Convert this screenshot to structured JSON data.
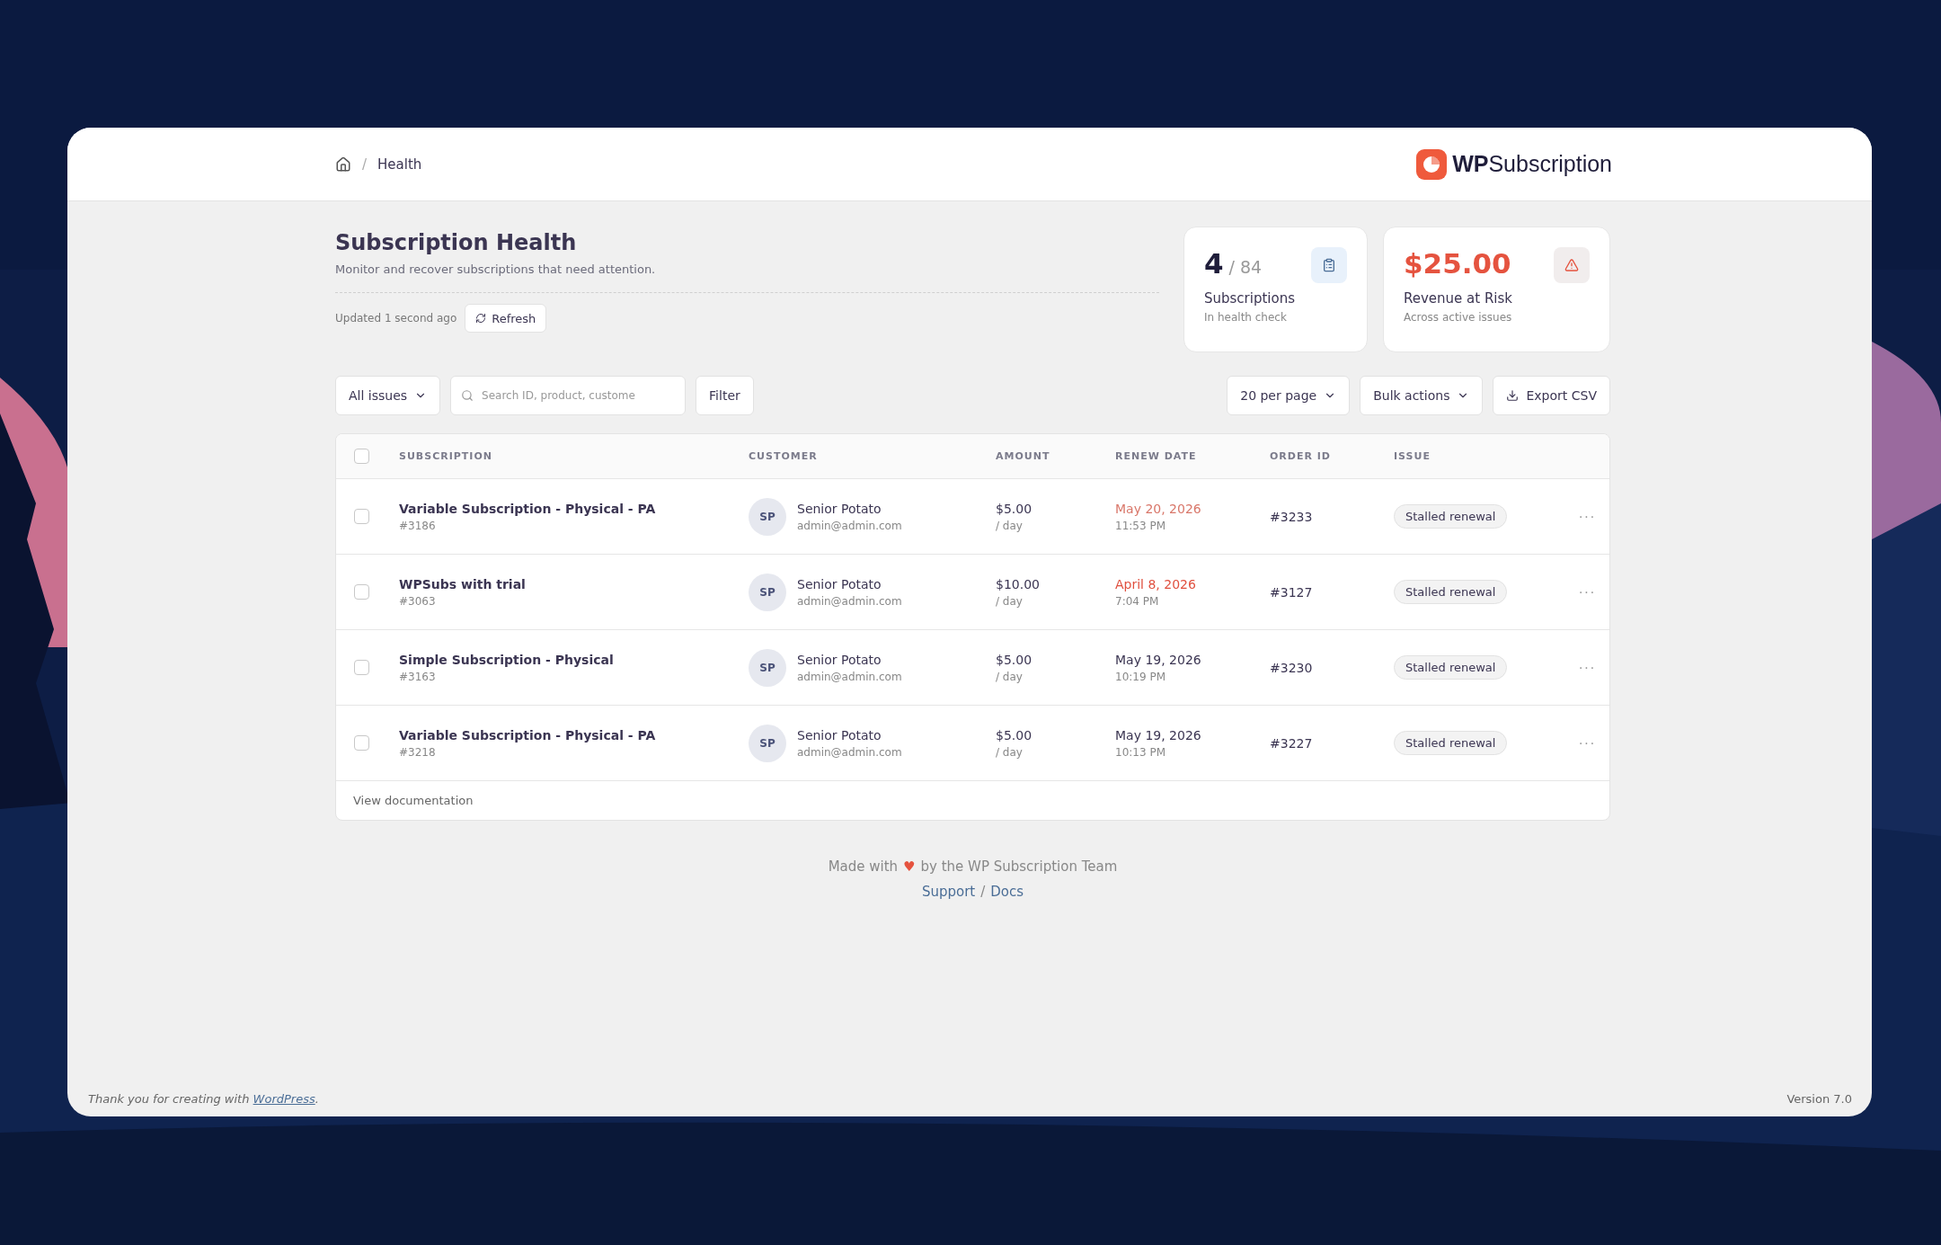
{
  "breadcrumb": {
    "separator": "/",
    "current": "Health"
  },
  "brand": {
    "name": "**WP**Subscription"
  },
  "page": {
    "title": "Subscription Health",
    "subtitle": "Monitor and recover subscriptions that need attention.",
    "updated": "Updated 1 second ago",
    "refresh": "Refresh"
  },
  "stats": [
    {
      "kind": "count",
      "value": "4",
      "total": "/ 84",
      "label": "Subscriptions",
      "note": "In health check"
    },
    {
      "kind": "money",
      "value": "$25.00",
      "label": "Revenue at Risk",
      "note": "Across active issues"
    }
  ],
  "toolbar": {
    "issue_filter": "All issues",
    "search": {
      "placeholder": "Search ID, product, custome"
    },
    "filter": "Filter",
    "per_page": "20 per page",
    "bulk": "Bulk actions",
    "export": "Export CSV"
  },
  "table": {
    "select_all": {
      "checked": false
    },
    "columns": [
      "SUBSCRIPTION",
      "CUSTOMER",
      "AMOUNT",
      "RENEW DATE",
      "ORDER ID",
      "ISSUE"
    ],
    "rows": [
      {
        "checked": false,
        "product": "Variable Subscription - Physical - PA",
        "id": "#3186",
        "initials": "SP",
        "customer": "Senior Potato",
        "email": "admin@admin.com",
        "amount": "$5.00",
        "period": "/ day",
        "date": "May 20, 2026",
        "time": "11:53 PM",
        "color": "#d9776a",
        "order": "#3233",
        "issue": "Stalled renewal",
        "more": "···"
      },
      {
        "checked": false,
        "product": "WPSubs with trial",
        "id": "#3063",
        "initials": "SP",
        "customer": "Senior Potato",
        "email": "admin@admin.com",
        "amount": "$10.00",
        "period": "/ day",
        "date": "April 8, 2026",
        "time": "7:04 PM",
        "color": "#e0503f",
        "order": "#3127",
        "issue": "Stalled renewal",
        "more": "···"
      },
      {
        "checked": false,
        "product": "Simple Subscription - Physical",
        "id": "#3163",
        "initials": "SP",
        "customer": "Senior Potato",
        "email": "admin@admin.com",
        "amount": "$5.00",
        "period": "/ day",
        "date": "May 19, 2026",
        "time": "10:19 PM",
        "color": "#3b3552",
        "order": "#3230",
        "issue": "Stalled renewal",
        "more": "···"
      },
      {
        "checked": false,
        "product": "Variable Subscription - Physical - PA",
        "id": "#3218",
        "initials": "SP",
        "customer": "Senior Potato",
        "email": "admin@admin.com",
        "amount": "$5.00",
        "period": "/ day",
        "date": "May 19, 2026",
        "time": "10:13 PM",
        "color": "#3b3552",
        "order": "#3227",
        "issue": "Stalled renewal",
        "more": "···"
      }
    ],
    "footer_link": "View documentation"
  },
  "credits": {
    "before": "Made with",
    "heart": "♥",
    "after": "by the WP Subscription Team",
    "links": [
      "Support",
      "Docs"
    ],
    "separator": "/"
  },
  "admin_footer": {
    "thanks": "Thank you for creating with",
    "link": "WordPress",
    "end": ".",
    "version": "Version 7.0"
  }
}
